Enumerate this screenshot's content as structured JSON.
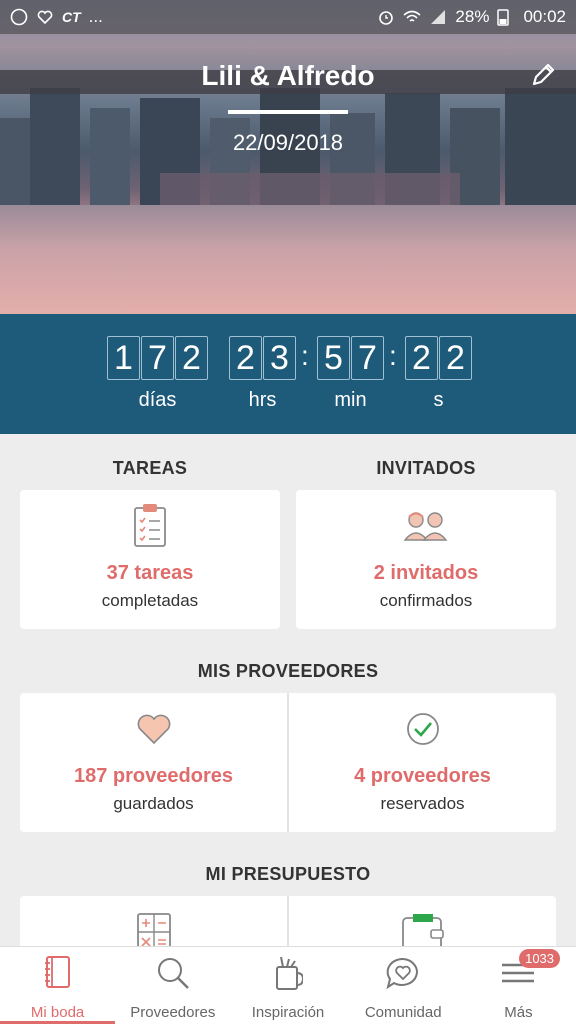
{
  "status_bar": {
    "carrier": "CT",
    "dots": "...",
    "battery": "28%",
    "time": "00:02"
  },
  "hero": {
    "title": "Lili & Alfredo",
    "date": "22/09/2018"
  },
  "countdown": {
    "days": [
      "1",
      "7",
      "2"
    ],
    "hours": [
      "2",
      "3"
    ],
    "minutes": [
      "5",
      "7"
    ],
    "seconds": [
      "2",
      "2"
    ],
    "labels": {
      "days": "días",
      "hours": "hrs",
      "minutes": "min",
      "seconds": "s"
    }
  },
  "tasks": {
    "title": "TAREAS",
    "count": "37 tareas",
    "sub": "completadas"
  },
  "guests": {
    "title": "INVITADOS",
    "count": "2 invitados",
    "sub": "confirmados"
  },
  "vendors": {
    "title": "MIS PROVEEDORES",
    "saved": {
      "count": "187 proveedores",
      "sub": "guardados"
    },
    "booked": {
      "count": "4 proveedores",
      "sub": "reservados"
    }
  },
  "budget": {
    "title": "MI PRESUPUESTO"
  },
  "nav": {
    "items": [
      {
        "label": "Mi boda",
        "icon": "notebook-icon"
      },
      {
        "label": "Proveedores",
        "icon": "search-icon"
      },
      {
        "label": "Inspiración",
        "icon": "inspiration-icon"
      },
      {
        "label": "Comunidad",
        "icon": "chat-heart-icon"
      },
      {
        "label": "Más",
        "icon": "menu-icon"
      }
    ],
    "badge": "1033"
  },
  "colors": {
    "accent": "#e06b6b",
    "countdown_bg": "#1e5a7a",
    "bg": "#ededed"
  }
}
